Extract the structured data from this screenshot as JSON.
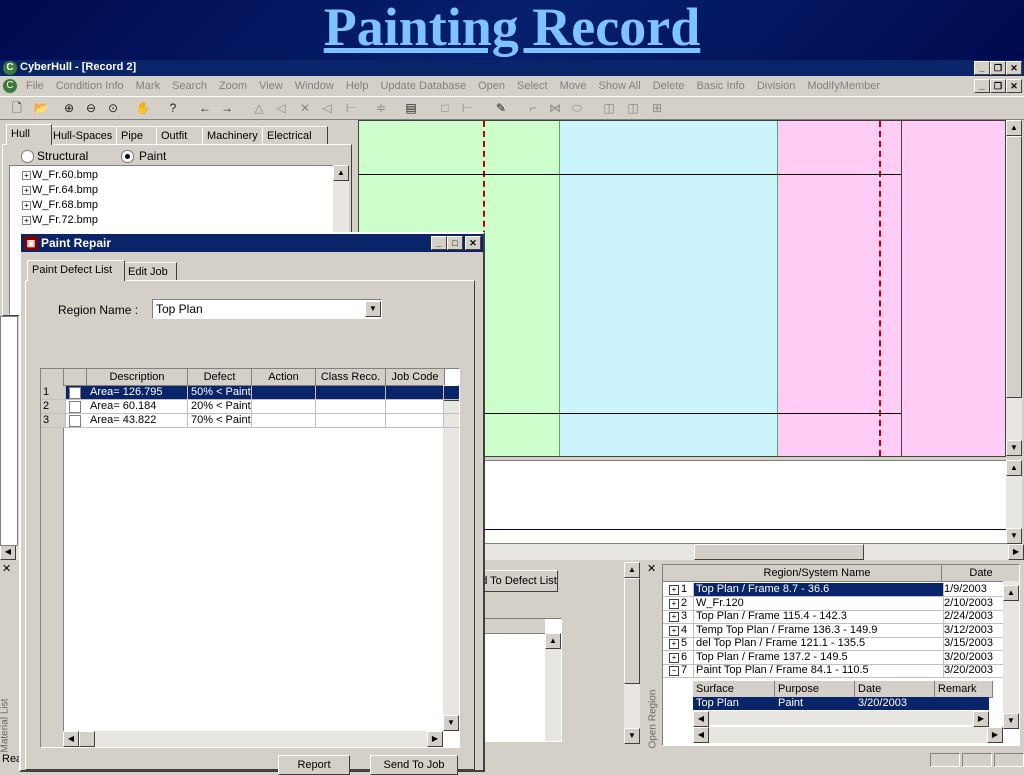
{
  "banner": {
    "title": "Painting Record"
  },
  "app": {
    "title": "CyberHull - [Record 2]"
  },
  "menu": [
    "File",
    "Condition Info",
    "Mark",
    "Search",
    "Zoom",
    "View",
    "Window",
    "Help",
    "Update Database",
    "Open",
    "Select",
    "Move",
    "Show All",
    "Delete",
    "Basic Info",
    "Division",
    "ModifyMember"
  ],
  "left_tabs": [
    "Hull",
    "Hull-Spaces",
    "Pipe",
    "Outfit",
    "Machinery",
    "Electrical"
  ],
  "radios": {
    "structural": "Structural",
    "paint": "Paint"
  },
  "tree": [
    "W_Fr.60.bmp",
    "W_Fr.64.bmp",
    "W_Fr.68.bmp",
    "W_Fr.72.bmp"
  ],
  "dialog": {
    "title": "Paint Repair",
    "tabs": [
      "Paint Defect List",
      "Edit Job"
    ],
    "region_label": "Region Name :",
    "region_value": "Top Plan",
    "columns": [
      "Description",
      "Defect",
      "Action",
      "Class Reco.",
      "Job Code"
    ],
    "rows": [
      {
        "n": "1",
        "desc": "Area= 126.795",
        "defect": "50% < Paint"
      },
      {
        "n": "2",
        "desc": "Area= 60.184",
        "defect": "20% < Paint"
      },
      {
        "n": "3",
        "desc": "Area= 43.822",
        "defect": "70% < Paint"
      }
    ],
    "report_btn": "Report",
    "send_btn": "Send To Job"
  },
  "mid_panel": {
    "add_btn": "d To Defect List"
  },
  "side_labels": {
    "material": "Material List",
    "open_region": "Open Region"
  },
  "region_grid": {
    "headers": [
      "Region/System Name",
      "Date"
    ],
    "rows": [
      {
        "n": "1",
        "name": "Top Plan / Frame 8.7 - 36.6",
        "date": "1/9/2003"
      },
      {
        "n": "2",
        "name": "W_Fr.120",
        "date": "2/10/2003"
      },
      {
        "n": "3",
        "name": "Top Plan / Frame 115.4 - 142.3",
        "date": "2/24/2003"
      },
      {
        "n": "4",
        "name": "Temp Top Plan / Frame 136.3 - 149.9",
        "date": "3/12/2003"
      },
      {
        "n": "5",
        "name": "del Top Plan / Frame 121.1 - 135.5",
        "date": "3/15/2003"
      },
      {
        "n": "6",
        "name": "Top Plan / Frame 137.2 - 149.5",
        "date": "3/20/2003"
      },
      {
        "n": "7",
        "name": "Paint Top Plan / Frame 84.1 - 110.5",
        "date": "3/20/2003"
      }
    ],
    "sub_headers": [
      "Surface",
      "Purpose",
      "Date",
      "Remark"
    ],
    "sub_row": {
      "surface": "Top Plan",
      "purpose": "Paint",
      "date": "3/20/2003",
      "remark": ""
    }
  },
  "status": {
    "left": "Rea"
  }
}
